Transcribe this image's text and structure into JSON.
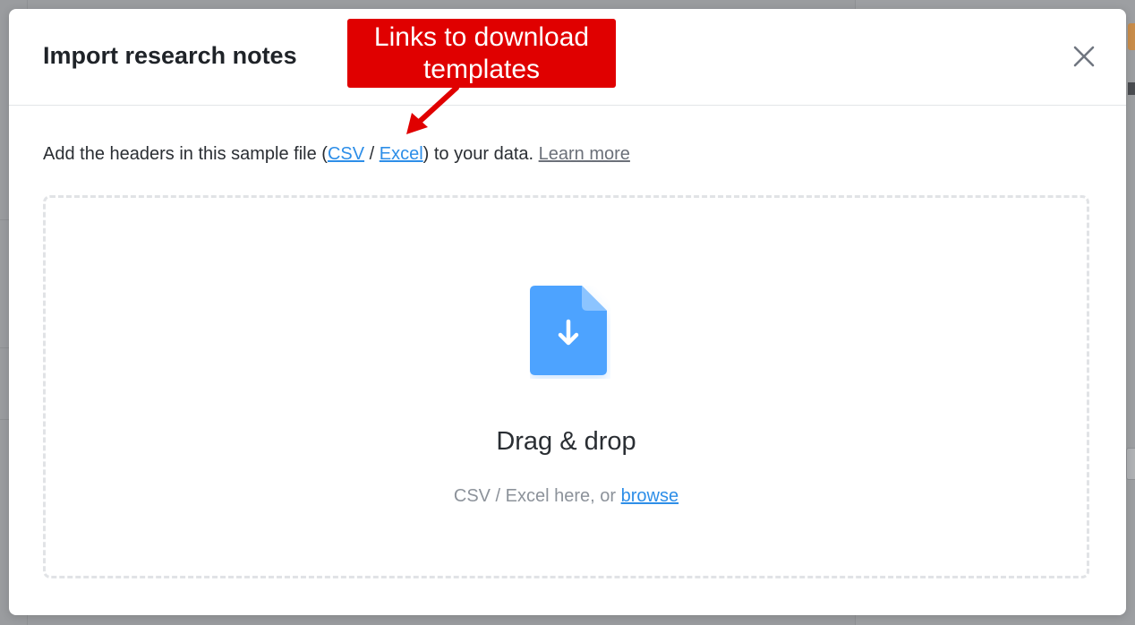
{
  "modal": {
    "title": "Import research notes",
    "close_icon": "close-icon"
  },
  "instructions": {
    "prefix": "Add the headers in this sample file (",
    "csv_link": "CSV",
    "separator": " / ",
    "excel_link": "Excel",
    "suffix": ") to your data. ",
    "learn_more": "Learn more"
  },
  "dropzone": {
    "icon": "file-download-icon",
    "title": "Drag & drop",
    "subtitle_prefix": "CSV / Excel here, or ",
    "browse_link": "browse"
  },
  "annotation": {
    "line1": "Links to download",
    "line2": "templates",
    "color": "#e00000"
  },
  "colors": {
    "link": "#2d8ee8",
    "file_icon": "#4da3ff"
  }
}
